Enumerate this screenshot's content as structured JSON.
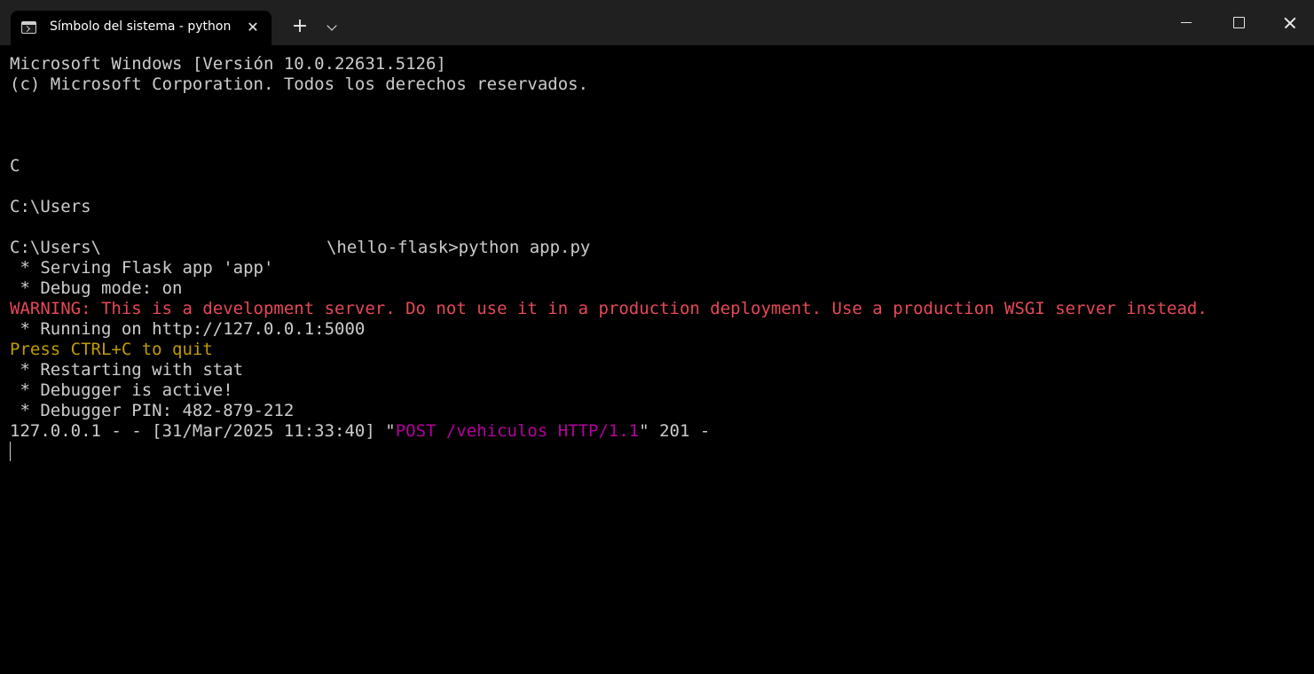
{
  "window": {
    "tab_title": "Símbolo del sistema - python",
    "tab_close_glyph": "✕",
    "new_tab_glyph": "+"
  },
  "terminal": {
    "line1": "Microsoft Windows [Versión 10.0.22631.5126]",
    "line2": "(c) Microsoft Corporation. Todos los derechos reservados.",
    "line3": "C",
    "line4": "C:\\Users",
    "line5_prefix": "C:\\Users\\",
    "line5_suffix": "\\hello-flask>python app.py",
    "line6": " * Serving Flask app 'app'",
    "line7": " * Debug mode: on",
    "line8_warning": "WARNING: This is a development server. Do not use it in a production deployment. Use a production WSGI server instead.",
    "line9": " * Running on http://127.0.0.1:5000",
    "line10_quit": "Press CTRL+C to quit",
    "line11": " * Restarting with stat",
    "line12": " * Debugger is active!",
    "line13": " * Debugger PIN: 482-879-212",
    "line14_prefix": "127.0.0.1 - - [31/Mar/2025 11:33:40] \"",
    "line14_request": "POST /vehiculos HTTP/1.1",
    "line14_suffix": "\" 201 -"
  },
  "colors": {
    "background": "#000000",
    "text": "#cccccc",
    "warning": "#e74856",
    "quit_hint": "#c19c00",
    "request": "#b4009e",
    "titlebar": "#202020"
  },
  "icons": {
    "tab_icon": "terminal-icon",
    "close": "close-icon",
    "dropdown": "chevron-down-icon",
    "minimize": "minimize-icon",
    "maximize": "maximize-icon",
    "window_close": "window-close-icon"
  }
}
